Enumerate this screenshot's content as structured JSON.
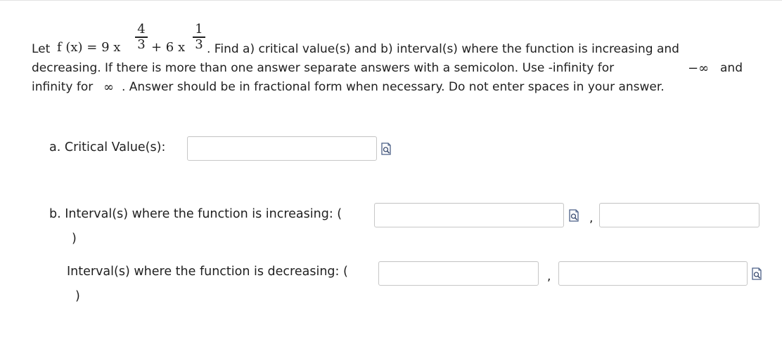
{
  "question": {
    "prefix": "Let",
    "func_lhs": "f (x) = 9 x",
    "exp1_num": "4",
    "exp1_den": "3",
    "plus_term": "+ 6 x",
    "exp2_num": "1",
    "exp2_den": "3",
    "line1_rest": ". Find a) critical value(s) and b) interval(s) where the function is increasing and",
    "line2": "decreasing. If there is more than one answer separate answers with a semicolon. Use -infinity for",
    "neg_inf": "−∞",
    "line2_end": "and",
    "line3_a": "infinity for",
    "inf": "∞",
    "line3_b": ". Answer should be in fractional form when necessary. Do not enter spaces in your answer."
  },
  "part_a": {
    "label": "a. Critical Value(s):",
    "value": ""
  },
  "part_b": {
    "increasing_label": "b. Interval(s) where the function is increasing: (",
    "increasing_close": ")",
    "decreasing_label": "Interval(s) where the function is decreasing: (",
    "decreasing_close": ")",
    "comma": ","
  },
  "icons": {
    "preview": "equation-preview-icon"
  }
}
